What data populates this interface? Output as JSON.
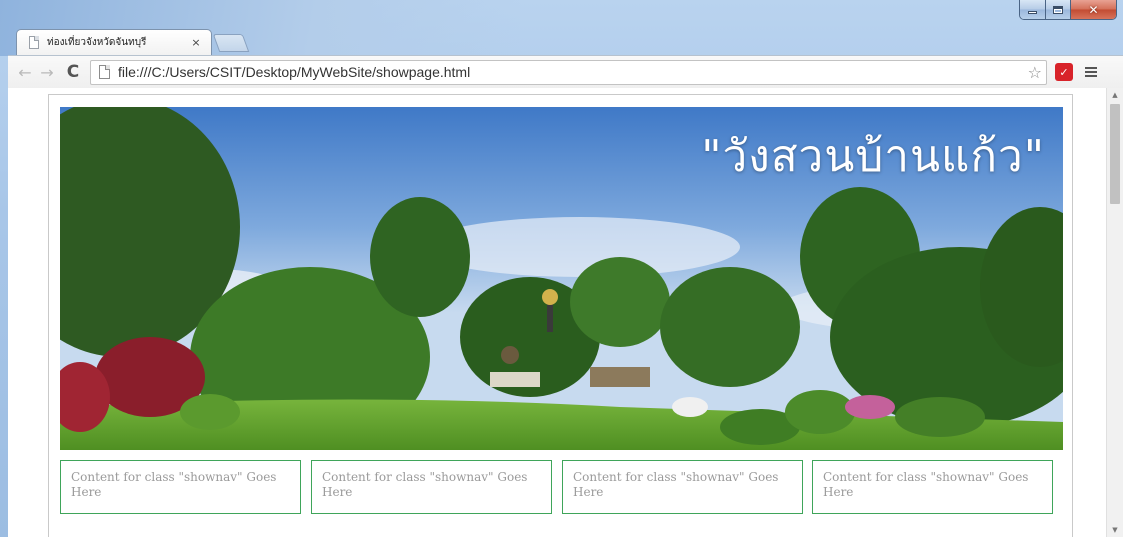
{
  "browser": {
    "tab_title": "ท่องเที่ยวจังหวัดจันทบุรี",
    "tab_close": "×",
    "url": "file:///C:/Users/CSIT/Desktop/MyWebSite/showpage.html",
    "icons": [
      "back-icon",
      "forward-icon",
      "reload-icon",
      "page-icon",
      "star-icon",
      "extension-icon",
      "menu-icon"
    ]
  },
  "page": {
    "banner_title": "\"วังสวนบ้านแก้ว\"",
    "nav_boxes": [
      "Content for class \"shownav\" Goes Here",
      "Content for class \"shownav\" Goes Here",
      "Content for class \"shownav\" Goes Here",
      "Content for class \"shownav\" Goes Here"
    ]
  },
  "colors": {
    "nav_border": "#3fa55a",
    "nav_text": "#9a9a9a",
    "close_button": "#c24b32"
  }
}
